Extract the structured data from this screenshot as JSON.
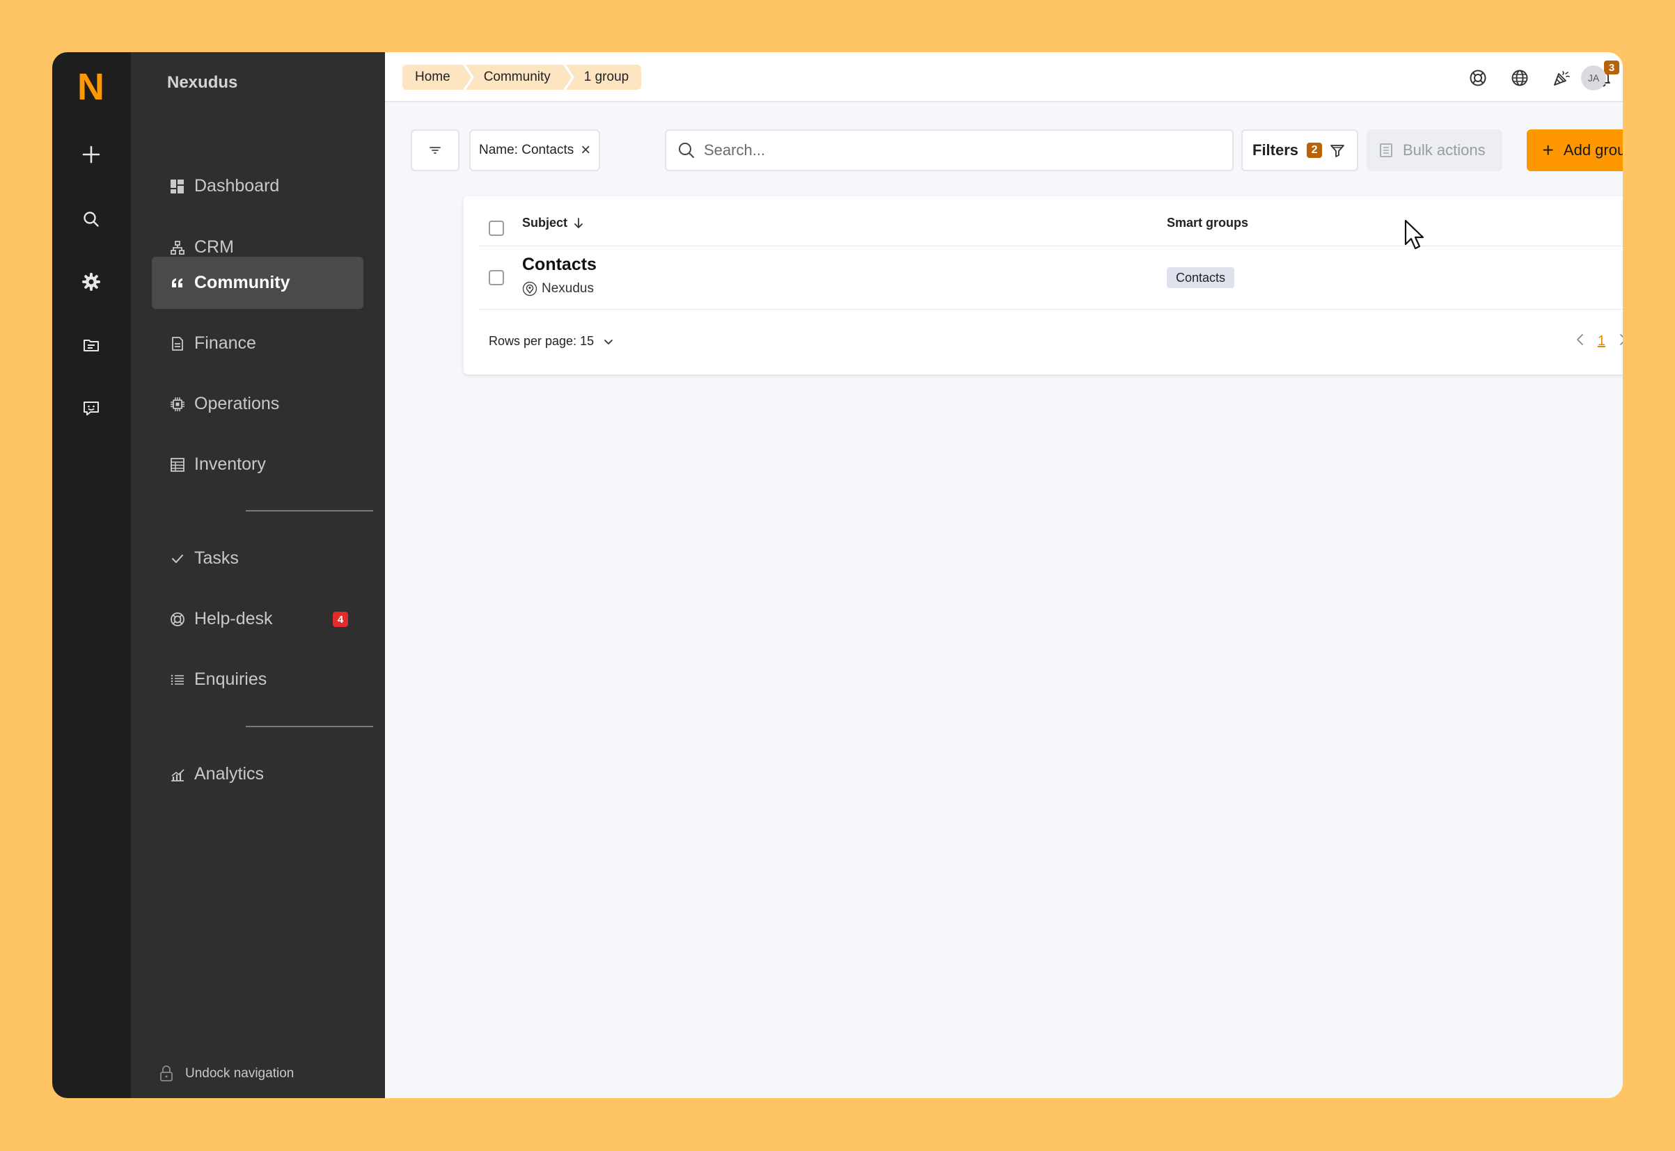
{
  "app": {
    "logo_letter": "N",
    "brand": "Nexudus"
  },
  "rail": {
    "icons": [
      "plus-icon",
      "search-icon",
      "gear-icon",
      "folder-icon",
      "chat-icon"
    ]
  },
  "nav": {
    "items": [
      {
        "label": "Dashboard",
        "icon": "dashboard-icon"
      },
      {
        "label": "CRM",
        "icon": "hierarchy-icon"
      },
      {
        "label": "Community",
        "icon": "quote-icon",
        "active": true
      },
      {
        "label": "Finance",
        "icon": "document-icon"
      },
      {
        "label": "Operations",
        "icon": "chip-icon"
      },
      {
        "label": "Inventory",
        "icon": "table-icon"
      },
      {
        "label": "Tasks",
        "icon": "check-icon"
      },
      {
        "label": "Help-desk",
        "icon": "lifebuoy-icon",
        "badge": "4"
      },
      {
        "label": "Enquiries",
        "icon": "list-icon"
      },
      {
        "label": "Analytics",
        "icon": "chart-icon"
      }
    ],
    "undock_label": "Undock navigation"
  },
  "breadcrumbs": [
    "Home",
    "Community",
    "1 group"
  ],
  "topbar": {
    "notification_count": "3",
    "avatar_initials": "JA"
  },
  "toolbar": {
    "chip_label": "Name: Contacts",
    "search_placeholder": "Search...",
    "filters_label": "Filters",
    "filters_count": "2",
    "bulk_label": "Bulk actions",
    "add_label": "Add group"
  },
  "table": {
    "columns": [
      "Subject",
      "Smart groups"
    ],
    "rows": [
      {
        "subject": "Contacts",
        "location": "Nexudus",
        "smart_group": "Contacts"
      }
    ],
    "rows_per_page_label": "Rows per page: 15",
    "current_page": "1"
  },
  "colors": {
    "accent": "#ff9800",
    "background": "#ffc565",
    "sidebar": "#2f2f2f",
    "rail": "#1e1e1e"
  }
}
